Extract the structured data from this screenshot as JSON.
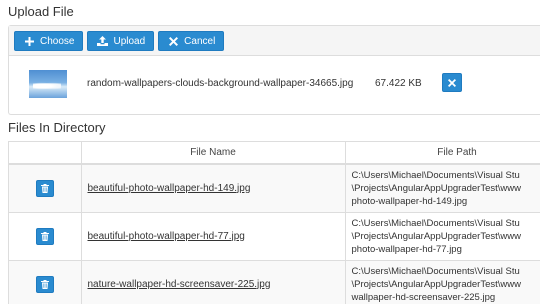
{
  "upload": {
    "title": "Upload File",
    "buttons": {
      "choose": "Choose",
      "upload": "Upload",
      "cancel": "Cancel"
    },
    "selected_file": {
      "name": "random-wallpapers-clouds-background-wallpaper-34665.jpg",
      "size": "67.422 KB"
    }
  },
  "directory": {
    "title": "Files In Directory",
    "columns": [
      "",
      "File Name",
      "File Path"
    ],
    "rows": [
      {
        "name": "beautiful-photo-wallpaper-hd-149.jpg",
        "path": "C:\\Users\\Michael\\Documents\\Visual Stu\n\\Projects\\AngularAppUpgraderTest\\www\nphoto-wallpaper-hd-149.jpg"
      },
      {
        "name": "beautiful-photo-wallpaper-hd-77.jpg",
        "path": "C:\\Users\\Michael\\Documents\\Visual Stu\n\\Projects\\AngularAppUpgraderTest\\www\nphoto-wallpaper-hd-77.jpg"
      },
      {
        "name": "nature-wallpaper-hd-screensaver-225.jpg",
        "path": "C:\\Users\\Michael\\Documents\\Visual Stu\n\\Projects\\AngularAppUpgraderTest\\www\nwallpaper-hd-screensaver-225.jpg"
      }
    ]
  },
  "colors": {
    "primary": "#2a8bd0",
    "panel_heading": "#f5f5f5",
    "border": "#dddddd"
  }
}
